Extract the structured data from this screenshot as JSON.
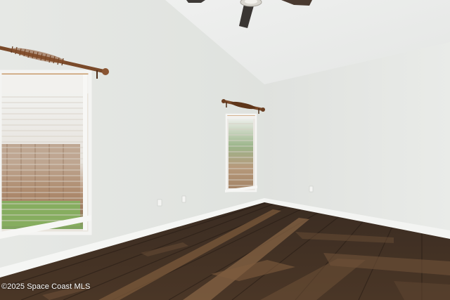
{
  "photo": {
    "subject": "empty-room",
    "watermark": "©2025 Space Coast MLS"
  },
  "colors": {
    "left_wall": "#e7e9e6",
    "right_wall": "#e4e6e3",
    "ceiling": "#eceeed",
    "baseboard": "#f4f5f3",
    "floor_dark": "#3b2d23",
    "floor_light": "#7a5a3e",
    "curtain_rod": "#7a4a2a"
  }
}
